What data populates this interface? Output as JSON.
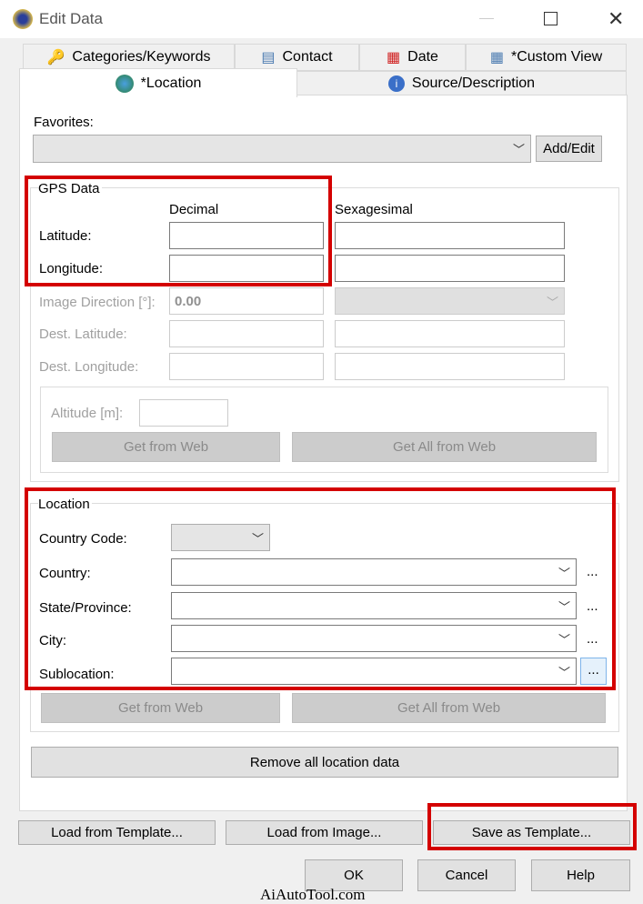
{
  "window": {
    "title": "Edit Data"
  },
  "tabs_row1": [
    {
      "label": "Categories/Keywords",
      "icon": "key-icon"
    },
    {
      "label": "Contact",
      "icon": "contact-card-icon"
    },
    {
      "label": "Date",
      "icon": "calendar-icon"
    },
    {
      "label": "*Custom View",
      "icon": "table-icon"
    }
  ],
  "tabs_row2": [
    {
      "label": "*Location",
      "icon": "globe-icon",
      "active": true
    },
    {
      "label": "Source/Description",
      "icon": "info-icon"
    }
  ],
  "favorites": {
    "label": "Favorites:",
    "value": "",
    "add_edit": "Add/Edit"
  },
  "gps": {
    "title": "GPS Data",
    "decimal": "Decimal",
    "sexagesimal": "Sexagesimal",
    "latitude": "Latitude:",
    "longitude": "Longitude:",
    "image_direction": "Image Direction [°]:",
    "image_direction_value": "0.00",
    "dest_latitude": "Dest. Latitude:",
    "dest_longitude": "Dest. Longitude:",
    "altitude": "Altitude [m]:",
    "get_from_web": "Get from Web",
    "get_all_from_web": "Get All from Web"
  },
  "location": {
    "title": "Location",
    "country_code": "Country Code:",
    "country": "Country:",
    "state": "State/Province:",
    "city": "City:",
    "sublocation": "Sublocation:",
    "more": "...",
    "get_from_web": "Get from Web",
    "get_all_from_web": "Get All from Web",
    "remove_all": "Remove all location data"
  },
  "footer": {
    "load_template": "Load from Template...",
    "load_image": "Load from Image...",
    "save_template": "Save as Template...",
    "ok": "OK",
    "cancel": "Cancel",
    "help": "Help"
  },
  "watermark": "AiAutoTool.com",
  "colors": {
    "highlight": "#d40000"
  }
}
